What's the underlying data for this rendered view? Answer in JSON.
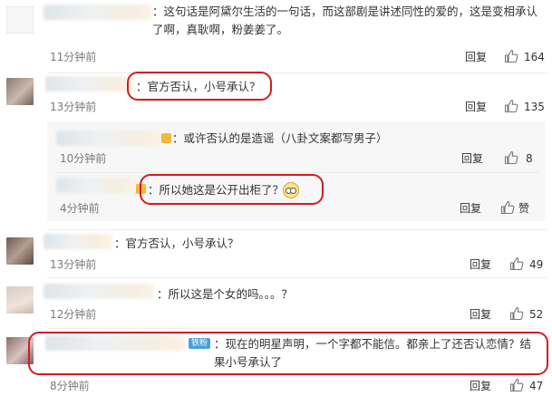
{
  "comments": [
    {
      "text": "：这句话是阿黛尔生活的一句话，而这部剧是讲述同性的爱的，这是变相承认了啊，真耿啊，粉姜姜了。",
      "time": "11分钟前",
      "reply_label": "回复",
      "likes": "164"
    },
    {
      "text": "：官方否认，小号承认？",
      "time": "13分钟前",
      "reply_label": "回复",
      "likes": "135",
      "sub_replies": [
        {
          "text": "：或许否认的是造谣（八卦文案都写男子）",
          "time": "10分钟前",
          "reply_label": "回复",
          "likes": "8"
        },
        {
          "text": "：所以她这是公开出柜了？",
          "time": "4分钟前",
          "reply_label": "回复",
          "likes": "赞"
        }
      ]
    },
    {
      "text": "：官方否认，小号承认？",
      "time": "13分钟前",
      "reply_label": "回复",
      "likes": "49"
    },
    {
      "text": "：所以这是个女的吗。。。？",
      "time": "12分钟前",
      "reply_label": "回复",
      "likes": "52"
    },
    {
      "badge": "铁粉",
      "text": "：现在的明星声明，一个字都不能信。都亲上了还否认恋情？结果小号承认了",
      "time": "8分钟前",
      "reply_label": "回复",
      "likes": "47"
    }
  ],
  "colors": {
    "highlight": "#d21b23",
    "sub_bg": "#f7f7f7",
    "time": "#7a7a7a",
    "badge": "#4aa0d8"
  },
  "icons": {
    "like": "thumbs-up-icon",
    "emoji": "glasses-face-emoji"
  }
}
